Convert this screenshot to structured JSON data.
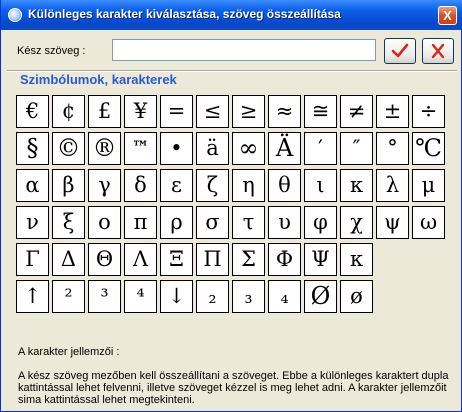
{
  "window": {
    "title": "Különleges karakter kiválasztása, szöveg összeállítása",
    "close_label": "X"
  },
  "input": {
    "label": "Kész szöveg :",
    "value": ""
  },
  "buttons": {
    "ok_icon": "checkmark-icon",
    "cancel_icon": "x-icon"
  },
  "section": {
    "title": "Szimbólumok, karakterek"
  },
  "symbols": [
    [
      "€",
      "¢",
      "£",
      "¥",
      "=",
      "≤",
      "≥",
      "≈",
      "≅",
      "≠",
      "±",
      "÷"
    ],
    [
      "§",
      "©",
      "®",
      "™",
      "•",
      "ä",
      "∞",
      "Ä",
      "′",
      "″",
      "°",
      "℃"
    ],
    [
      "α",
      "β",
      "γ",
      "δ",
      "ε",
      "ζ",
      "η",
      "θ",
      "ι",
      "κ",
      "λ",
      "μ"
    ],
    [
      "ν",
      "ξ",
      "ο",
      "π",
      "ρ",
      "σ",
      "τ",
      "υ",
      "φ",
      "χ",
      "ψ",
      "ω"
    ],
    [
      "Γ",
      "Δ",
      "Θ",
      "Λ",
      "Ξ",
      "Π",
      "Σ",
      "Φ",
      "Ψ",
      "κ"
    ],
    [
      "↑",
      "²",
      "³",
      "⁴",
      "↓",
      "₂",
      "₃",
      "₄",
      "Ø",
      "ø"
    ]
  ],
  "description": {
    "label": "A karakter jellemzői :",
    "help": "A kész szöveg mezőben kell összeállítani a szöveget. Ebbe a különleges karaktert dupla kattintással lehet felvenni, illetve szöveget kézzel is meg lehet adni. A karakter jellemzőit sima kattintással lehet megtekinteni."
  }
}
